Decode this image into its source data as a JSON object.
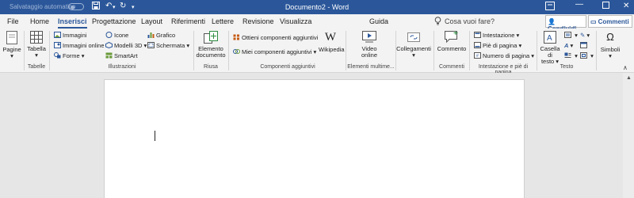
{
  "titlebar": {
    "autosave_label": "Salvataggio automatico",
    "document_title": "Documento2 - Word",
    "save_icon": "save-icon",
    "undo_icon": "undo-icon",
    "redo_icon": "redo-icon"
  },
  "tabs": [
    {
      "label": "File"
    },
    {
      "label": "Home"
    },
    {
      "label": "Inserisci"
    },
    {
      "label": "Progettazione"
    },
    {
      "label": "Layout"
    },
    {
      "label": "Riferimenti"
    },
    {
      "label": "Lettere"
    },
    {
      "label": "Revisione"
    },
    {
      "label": "Visualizza"
    },
    {
      "label": "Guida"
    }
  ],
  "search": {
    "placeholder": "Cosa vuoi fare?"
  },
  "share_label": "Condividi",
  "comments_label": "Commenti",
  "ribbon": {
    "pages": {
      "label": "Pagine"
    },
    "tables": {
      "button": "Tabella",
      "group": "Tabelle"
    },
    "illustrations": {
      "images": "Immagini",
      "online_images": "Immagini online",
      "shapes": "Forme",
      "icons": "Icone",
      "models3d": "Modelli 3D",
      "smartart": "SmartArt",
      "chart": "Grafico",
      "screenshot": "Schermata",
      "group": "Illustrazioni"
    },
    "reuse": {
      "button_line1": "Elemento",
      "button_line2": "documento",
      "group": "Riusa"
    },
    "addins": {
      "get_addins": "Ottieni componenti aggiuntivi",
      "my_addins": "Miei componenti aggiuntivi",
      "wikipedia": "Wikipedia",
      "group": "Componenti aggiuntivi"
    },
    "media": {
      "button_line1": "Video",
      "button_line2": "online",
      "group": "Elementi multime..."
    },
    "links": {
      "button": "Collegamenti"
    },
    "comments": {
      "button": "Commento",
      "group": "Commenti"
    },
    "header_footer": {
      "header": "Intestazione",
      "footer": "Piè di pagina",
      "page_number": "Numero di pagina",
      "group": "Intestazione e piè di pagina"
    },
    "text": {
      "button_line1": "Casella di",
      "button_line2": "testo",
      "group": "Testo"
    },
    "symbols": {
      "button": "Simboli"
    }
  },
  "accent_color": "#2b579a"
}
